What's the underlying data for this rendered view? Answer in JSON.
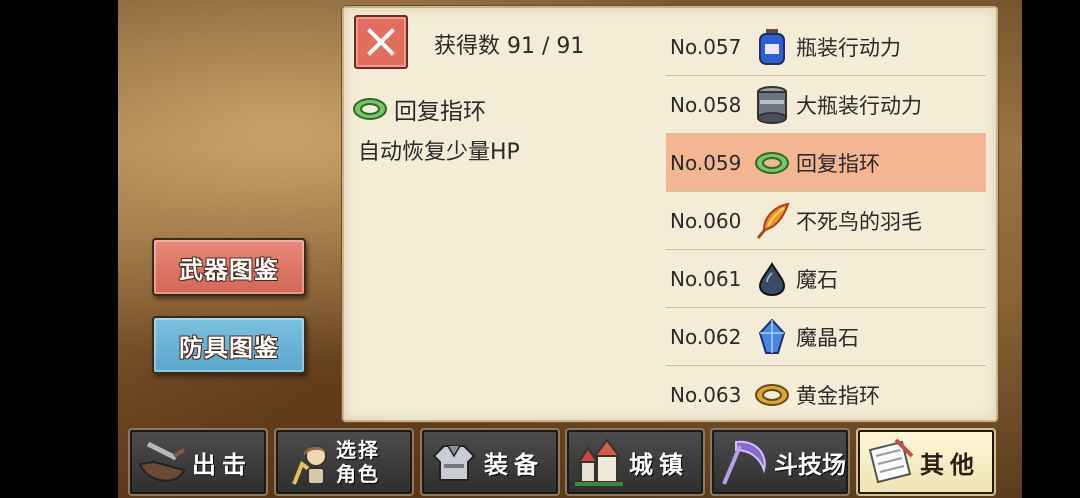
{
  "side_buttons": {
    "weapon_index": "武器图鉴",
    "armor_index": "防具图鉴"
  },
  "panel": {
    "count_text": "获得数 91 / 91",
    "selected_item": {
      "name": "回复指环",
      "description": "自动恢复少量HP",
      "icon": "green-ring-icon"
    },
    "items": [
      {
        "no": "No.057",
        "name": "瓶装行动力",
        "icon": "blue-bottle-icon"
      },
      {
        "no": "No.058",
        "name": "大瓶装行动力",
        "icon": "steel-can-icon"
      },
      {
        "no": "No.059",
        "name": "回复指环",
        "icon": "green-ring-icon",
        "selected": true
      },
      {
        "no": "No.060",
        "name": "不死鸟的羽毛",
        "icon": "phoenix-feather-icon"
      },
      {
        "no": "No.061",
        "name": "魔石",
        "icon": "dark-stone-icon"
      },
      {
        "no": "No.062",
        "name": "魔晶石",
        "icon": "blue-crystal-icon"
      },
      {
        "no": "No.063",
        "name": "黄金指环",
        "icon": "gold-ring-icon"
      }
    ]
  },
  "tabs": [
    {
      "label": "出击",
      "icon": "sortie-icon"
    },
    {
      "label": "选择 角色",
      "icon": "character-select-icon"
    },
    {
      "label": "装备",
      "icon": "armor-equip-icon"
    },
    {
      "label": "城镇",
      "icon": "town-icon"
    },
    {
      "label": "斗技场",
      "icon": "arena-scythe-icon"
    },
    {
      "label": "其他",
      "icon": "scroll-other-icon",
      "active": true
    }
  ],
  "colors": {
    "selected_row": "#f4b593",
    "weapon_button": "#e07b6b",
    "armor_button": "#69b2d8",
    "close_button": "#e46d5f"
  }
}
